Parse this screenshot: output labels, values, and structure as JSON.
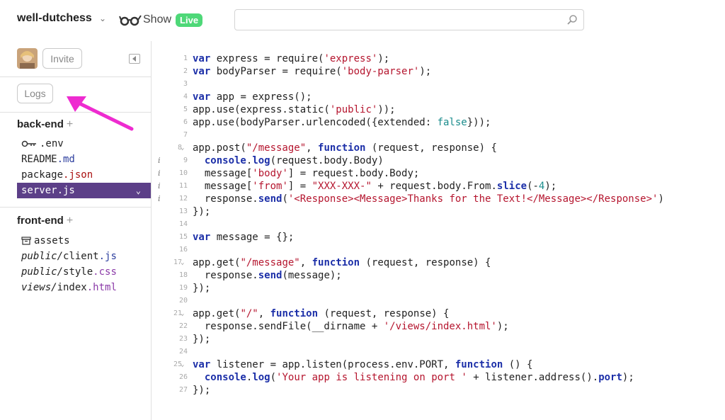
{
  "header": {
    "project_name": "well-dutchess",
    "show_label": "Show",
    "live_badge": "Live",
    "search": {
      "value": "",
      "placeholder": ""
    }
  },
  "sidebar": {
    "invite_label": "Invite",
    "logs_label": "Logs",
    "sections": [
      {
        "title": "back-end",
        "add": "+",
        "files": [
          {
            "name": ".env",
            "icon": "key-icon"
          },
          {
            "name": "README",
            "ext": ".md"
          },
          {
            "name": "package",
            "ext": ".json"
          },
          {
            "name": "server.js",
            "active": true
          }
        ]
      },
      {
        "title": "front-end",
        "add": "+",
        "files": [
          {
            "name": "assets",
            "icon": "box-icon"
          },
          {
            "dir": "public/",
            "name": "client",
            "ext": ".js"
          },
          {
            "dir": "public/",
            "name": "style",
            "ext": ".css"
          },
          {
            "dir": "views/",
            "name": "index",
            "ext": ".html"
          }
        ]
      }
    ]
  },
  "editor": {
    "line_numbers": [
      "1",
      "2",
      "3",
      "4",
      "5",
      "6",
      "7",
      "8",
      "9",
      "10",
      "11",
      "12",
      "13",
      "14",
      "15",
      "16",
      "17",
      "18",
      "19",
      "20",
      "21",
      "22",
      "23",
      "24",
      "25",
      "26",
      "27"
    ],
    "info_marker": "i",
    "info_lines": [
      9,
      10,
      11,
      12
    ]
  },
  "colors": {
    "accent_purple": "#5c3f88",
    "live_green": "#4ed878",
    "keyword_blue": "#1c2fa8",
    "string_red": "#b5152e",
    "annotation_pink": "#ee2bd0"
  }
}
